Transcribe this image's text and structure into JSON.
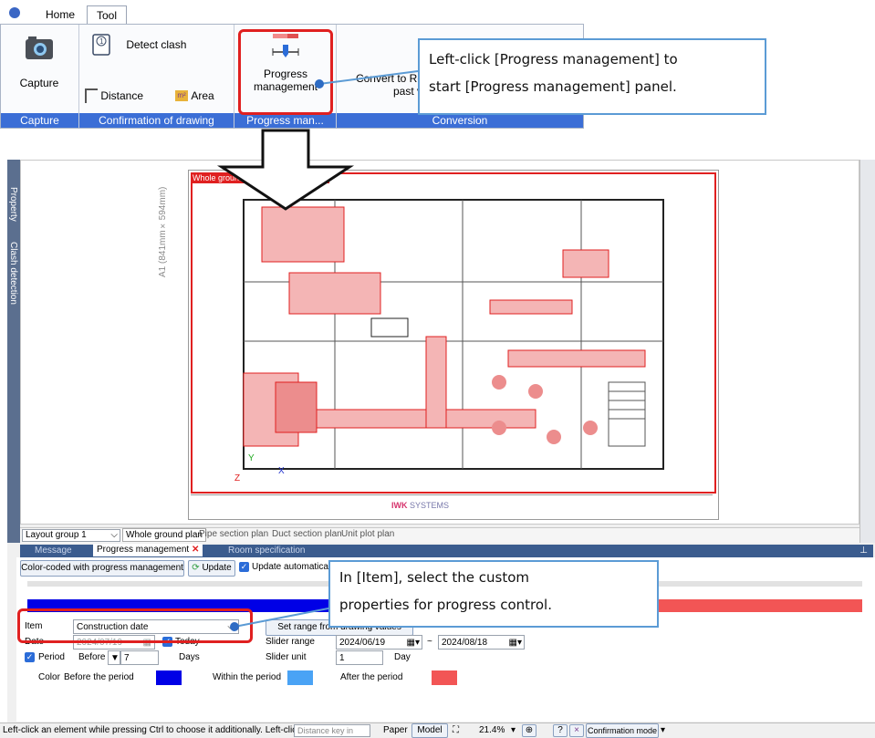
{
  "ribbon": {
    "tabs": [
      "Home",
      "Tool"
    ],
    "groups": {
      "capture": {
        "label": "Capture",
        "buttons": {
          "capture": "Capture"
        }
      },
      "confirmation": {
        "label": "Confirmation of drawing",
        "buttons": {
          "detect_clash": "Detect clash",
          "distance": "Distance",
          "area": "Area"
        }
      },
      "progress": {
        "label": "Progress man...",
        "buttons": {
          "progress_line1": "Progress",
          "progress_line2": "management"
        }
      },
      "conversion": {
        "label": "Conversion",
        "buttons": {
          "convert_line1": "Convert to Re",
          "convert_line2": "past v"
        }
      }
    }
  },
  "callouts": {
    "ribbon_line1": "Left-click [Progress management] to",
    "ribbon_line2": "start [Progress management] panel.",
    "item_line1": "In [Item], select the custom",
    "item_line2": "properties for progress control."
  },
  "left_dock": {
    "property": "Property",
    "clash": "Clash detection"
  },
  "drawing": {
    "sheet_title": "Whole ground floor plan",
    "paper_size": "A1 (841mm×594mm)",
    "company": "SYSTEMS",
    "axis_y": "Y",
    "axis_x": "X",
    "axis_z": "Z"
  },
  "sheet_tabs": {
    "layout_group": "Layout group 1",
    "tabs": [
      "Whole ground plan",
      "Pipe section plan",
      "Duct section plan",
      "Unit plot plan"
    ]
  },
  "panel_tabs": [
    "Message",
    "Progress management",
    "Room specification"
  ],
  "progress_panel": {
    "color_coded_button": "Color-coded with progress management",
    "update_button": "Update",
    "update_auto": "Update automatically",
    "item_label": "Item",
    "item_value": "Construction date",
    "set_range_button": "Set range from drawing values",
    "date_label": "Date",
    "date_value": "2024/07/19",
    "today": "Today",
    "period_label": "Period",
    "before_label": "Before",
    "period_value": "7",
    "days": "Days",
    "slider_range_label": "Slider range",
    "range_start": "2024/06/19",
    "range_sep": "~",
    "range_end": "2024/08/18",
    "slider_unit_label": "Slider unit",
    "slider_unit_value": "1",
    "day": "Day",
    "color_label": "Color",
    "before_period": "Before the period",
    "within_period": "Within the period",
    "after_period": "After the period",
    "colors": {
      "before": "#0000e6",
      "within": "#4aa3f5",
      "after": "#f25555"
    }
  },
  "status_bar": {
    "hint": "Left-click an element while pressing Ctrl to choose it additionally. Left-click el...",
    "distance_key": "Distance key in",
    "paper": "Paper",
    "model": "Model",
    "zoom": "21.4%",
    "mode": "Confirmation mode"
  }
}
